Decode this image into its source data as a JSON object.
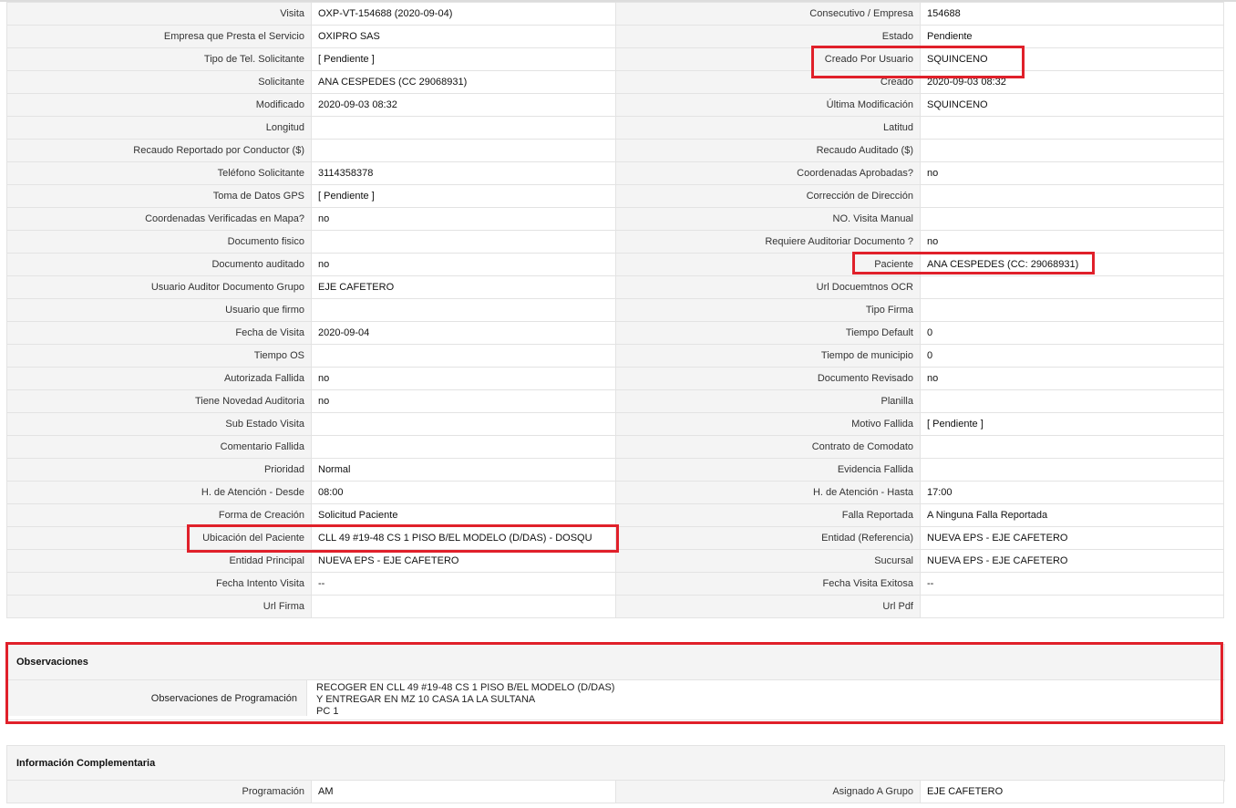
{
  "details": {
    "rows": [
      {
        "l1": "Visita",
        "v1": "OXP-VT-154688 (2020-09-04)",
        "l2": "Consecutivo / Empresa",
        "v2": "154688"
      },
      {
        "l1": "Empresa que Presta el Servicio",
        "v1": "OXIPRO SAS",
        "l2": "Estado",
        "v2": "Pendiente"
      },
      {
        "l1": "Tipo de Tel. Solicitante",
        "v1": "[ Pendiente ]",
        "l2": "Creado Por Usuario",
        "v2": "SQUINCENO"
      },
      {
        "l1": "Solicitante",
        "v1": "ANA CESPEDES (CC 29068931)",
        "l2": "Creado",
        "v2": "2020-09-03 08:32"
      },
      {
        "l1": "Modificado",
        "v1": "2020-09-03 08:32",
        "l2": "Última Modificación",
        "v2": " SQUINCENO"
      },
      {
        "l1": "Longitud",
        "v1": "",
        "l2": "Latitud",
        "v2": ""
      },
      {
        "l1": "Recaudo Reportado por Conductor ($)",
        "v1": "",
        "l2": "Recaudo Auditado ($)",
        "v2": ""
      },
      {
        "l1": "Teléfono Solicitante",
        "v1": "3114358378",
        "l2": "Coordenadas Aprobadas?",
        "v2": " no"
      },
      {
        "l1": "Toma de Datos GPS",
        "v1": "[ Pendiente ]",
        "l2": "Corrección de Dirección",
        "v2": ""
      },
      {
        "l1": "Coordenadas Verificadas en Mapa?",
        "v1": " no",
        "l2": "NO. Visita Manual",
        "v2": ""
      },
      {
        "l1": "Documento fisico",
        "v1": "",
        "l2": "Requiere Auditoriar Documento ?",
        "v2": " no"
      },
      {
        "l1": "Documento auditado",
        "v1": " no",
        "l2": "Paciente",
        "v2": "ANA CESPEDES (CC: 29068931)"
      },
      {
        "l1": "Usuario Auditor Documento Grupo",
        "v1": "EJE CAFETERO",
        "l2": "Url Docuemtnos OCR",
        "v2": ""
      },
      {
        "l1": "Usuario que firmo",
        "v1": "",
        "l2": "Tipo Firma",
        "v2": ""
      },
      {
        "l1": "Fecha de Visita",
        "v1": " 2020-09-04",
        "l2": "Tiempo Default",
        "v2": "0"
      },
      {
        "l1": "Tiempo OS",
        "v1": "",
        "l2": "Tiempo de municipio",
        "v2": "0"
      },
      {
        "l1": "Autorizada Fallida",
        "v1": " no",
        "l2": "Documento Revisado",
        "v2": " no"
      },
      {
        "l1": "Tiene Novedad Auditoria",
        "v1": " no",
        "l2": "Planilla",
        "v2": ""
      },
      {
        "l1": "Sub Estado Visita",
        "v1": "",
        "l2": "Motivo Fallida",
        "v2": "[ Pendiente ]"
      },
      {
        "l1": "Comentario Fallida",
        "v1": "",
        "l2": "Contrato de Comodato",
        "v2": ""
      },
      {
        "l1": "Prioridad",
        "v1": "Normal",
        "l2": "Evidencia Fallida",
        "v2": ""
      },
      {
        "l1": "H. de Atención - Desde",
        "v1": "08:00",
        "l2": "H. de Atención - Hasta",
        "v2": "17:00"
      },
      {
        "l1": "Forma de Creación",
        "v1": "Solicitud Paciente",
        "l2": "Falla Reportada",
        "v2": "A Ninguna Falla Reportada"
      },
      {
        "l1": "Ubicación del Paciente",
        "v1": "CLL 49 #19-48 CS 1 PISO B/EL MODELO (D/DAS) - DOSQU",
        "l2": "Entidad (Referencia)",
        "v2": "NUEVA EPS - EJE CAFETERO"
      },
      {
        "l1": "Entidad Principal",
        "v1": "NUEVA EPS - EJE CAFETERO",
        "l2": "Sucursal",
        "v2": "NUEVA EPS - EJE CAFETERO"
      },
      {
        "l1": "Fecha Intento Visita",
        "v1": " --",
        "l2": "Fecha Visita Exitosa",
        "v2": " --"
      },
      {
        "l1": "Url Firma",
        "v1": "",
        "l2": "Url Pdf",
        "v2": ""
      }
    ]
  },
  "observaciones": {
    "title": "Observaciones",
    "label": "Observaciones de Programación",
    "value": " RECOGER EN CLL 49 #19-48 CS 1 PISO B/EL MODELO (D/DAS)\nY ENTREGAR EN MZ 10 CASA 1A LA SULTANA\nPC 1"
  },
  "complementaria": {
    "title": "Información Complementaria",
    "rows": [
      {
        "l1": "Programación",
        "v1": "AM",
        "l2": "Asignado A Grupo",
        "v2": "EJE CAFETERO"
      }
    ]
  },
  "highlight_color": "#e0202a"
}
